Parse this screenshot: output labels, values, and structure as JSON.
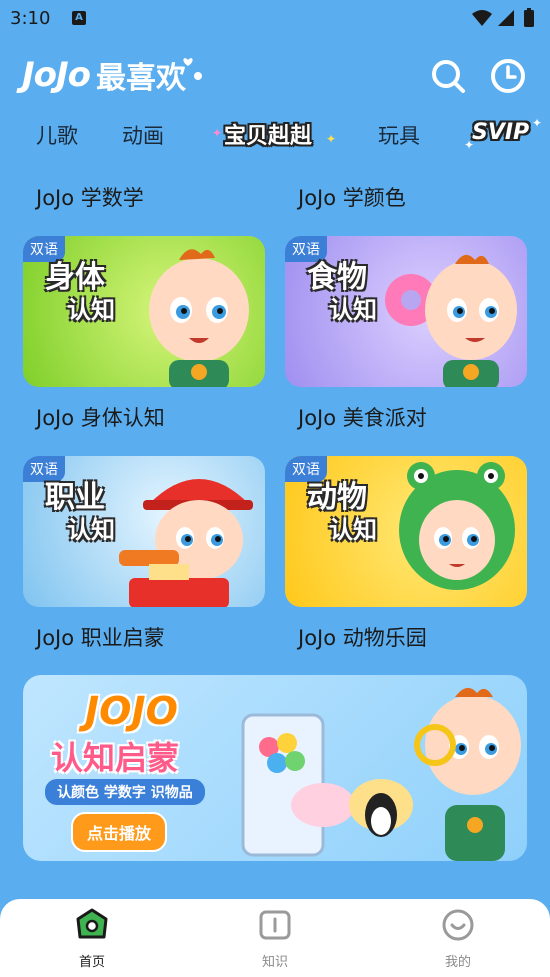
{
  "status": {
    "time": "3:10",
    "sim": "A"
  },
  "header": {
    "logo_text": "JoJo",
    "title": "最喜欢"
  },
  "tabs": [
    {
      "label": "儿歌"
    },
    {
      "label": "动画"
    },
    {
      "label": "宝贝赳赳"
    },
    {
      "label": "玩具"
    },
    {
      "label": "SVIP"
    }
  ],
  "sections": [
    {
      "left": "JoJo 学数学",
      "right": "JoJo 学颜色"
    }
  ],
  "cards": [
    {
      "badge": "双语",
      "title_top": "身体",
      "title_bottom": "认知",
      "caption": "JoJo 身体认知",
      "bg": "#a6e04a"
    },
    {
      "badge": "双语",
      "title_top": "食物",
      "title_bottom": "认知",
      "caption": "JoJo 美食派对",
      "bg": "#b8a6f0"
    },
    {
      "badge": "双语",
      "title_top": "职业",
      "title_bottom": "认知",
      "caption": "JoJo 职业启蒙",
      "bg": "#7fc8f5"
    },
    {
      "badge": "双语",
      "title_top": "动物",
      "title_bottom": "认知",
      "caption": "JoJo 动物乐园",
      "bg": "#ffd23a"
    }
  ],
  "banner": {
    "logo": "JOJO",
    "title": "认知启蒙",
    "subtitle": "认颜色 学数字 识物品",
    "button": "点击播放"
  },
  "nav": [
    {
      "label": "首页",
      "icon": "home-icon"
    },
    {
      "label": "知识",
      "icon": "book-icon"
    },
    {
      "label": "我的",
      "icon": "smile-icon"
    }
  ]
}
